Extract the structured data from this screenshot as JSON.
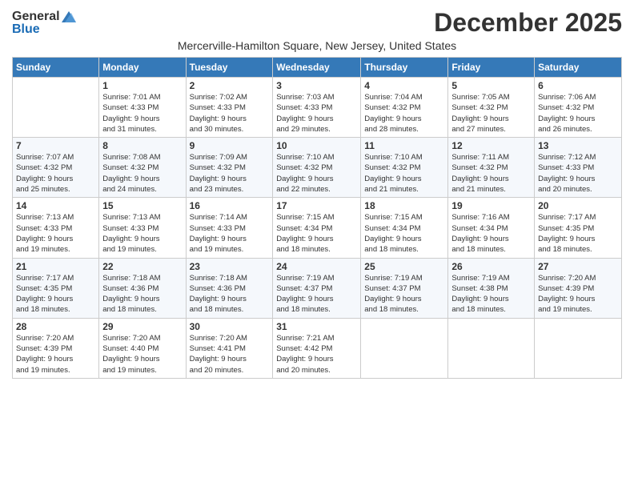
{
  "logo": {
    "general": "General",
    "blue": "Blue"
  },
  "title": "December 2025",
  "subtitle": "Mercerville-Hamilton Square, New Jersey, United States",
  "days_of_week": [
    "Sunday",
    "Monday",
    "Tuesday",
    "Wednesday",
    "Thursday",
    "Friday",
    "Saturday"
  ],
  "weeks": [
    [
      {
        "day": "",
        "info": ""
      },
      {
        "day": "1",
        "info": "Sunrise: 7:01 AM\nSunset: 4:33 PM\nDaylight: 9 hours\nand 31 minutes."
      },
      {
        "day": "2",
        "info": "Sunrise: 7:02 AM\nSunset: 4:33 PM\nDaylight: 9 hours\nand 30 minutes."
      },
      {
        "day": "3",
        "info": "Sunrise: 7:03 AM\nSunset: 4:33 PM\nDaylight: 9 hours\nand 29 minutes."
      },
      {
        "day": "4",
        "info": "Sunrise: 7:04 AM\nSunset: 4:32 PM\nDaylight: 9 hours\nand 28 minutes."
      },
      {
        "day": "5",
        "info": "Sunrise: 7:05 AM\nSunset: 4:32 PM\nDaylight: 9 hours\nand 27 minutes."
      },
      {
        "day": "6",
        "info": "Sunrise: 7:06 AM\nSunset: 4:32 PM\nDaylight: 9 hours\nand 26 minutes."
      }
    ],
    [
      {
        "day": "7",
        "info": "Sunrise: 7:07 AM\nSunset: 4:32 PM\nDaylight: 9 hours\nand 25 minutes."
      },
      {
        "day": "8",
        "info": "Sunrise: 7:08 AM\nSunset: 4:32 PM\nDaylight: 9 hours\nand 24 minutes."
      },
      {
        "day": "9",
        "info": "Sunrise: 7:09 AM\nSunset: 4:32 PM\nDaylight: 9 hours\nand 23 minutes."
      },
      {
        "day": "10",
        "info": "Sunrise: 7:10 AM\nSunset: 4:32 PM\nDaylight: 9 hours\nand 22 minutes."
      },
      {
        "day": "11",
        "info": "Sunrise: 7:10 AM\nSunset: 4:32 PM\nDaylight: 9 hours\nand 21 minutes."
      },
      {
        "day": "12",
        "info": "Sunrise: 7:11 AM\nSunset: 4:32 PM\nDaylight: 9 hours\nand 21 minutes."
      },
      {
        "day": "13",
        "info": "Sunrise: 7:12 AM\nSunset: 4:33 PM\nDaylight: 9 hours\nand 20 minutes."
      }
    ],
    [
      {
        "day": "14",
        "info": "Sunrise: 7:13 AM\nSunset: 4:33 PM\nDaylight: 9 hours\nand 19 minutes."
      },
      {
        "day": "15",
        "info": "Sunrise: 7:13 AM\nSunset: 4:33 PM\nDaylight: 9 hours\nand 19 minutes."
      },
      {
        "day": "16",
        "info": "Sunrise: 7:14 AM\nSunset: 4:33 PM\nDaylight: 9 hours\nand 19 minutes."
      },
      {
        "day": "17",
        "info": "Sunrise: 7:15 AM\nSunset: 4:34 PM\nDaylight: 9 hours\nand 18 minutes."
      },
      {
        "day": "18",
        "info": "Sunrise: 7:15 AM\nSunset: 4:34 PM\nDaylight: 9 hours\nand 18 minutes."
      },
      {
        "day": "19",
        "info": "Sunrise: 7:16 AM\nSunset: 4:34 PM\nDaylight: 9 hours\nand 18 minutes."
      },
      {
        "day": "20",
        "info": "Sunrise: 7:17 AM\nSunset: 4:35 PM\nDaylight: 9 hours\nand 18 minutes."
      }
    ],
    [
      {
        "day": "21",
        "info": "Sunrise: 7:17 AM\nSunset: 4:35 PM\nDaylight: 9 hours\nand 18 minutes."
      },
      {
        "day": "22",
        "info": "Sunrise: 7:18 AM\nSunset: 4:36 PM\nDaylight: 9 hours\nand 18 minutes."
      },
      {
        "day": "23",
        "info": "Sunrise: 7:18 AM\nSunset: 4:36 PM\nDaylight: 9 hours\nand 18 minutes."
      },
      {
        "day": "24",
        "info": "Sunrise: 7:19 AM\nSunset: 4:37 PM\nDaylight: 9 hours\nand 18 minutes."
      },
      {
        "day": "25",
        "info": "Sunrise: 7:19 AM\nSunset: 4:37 PM\nDaylight: 9 hours\nand 18 minutes."
      },
      {
        "day": "26",
        "info": "Sunrise: 7:19 AM\nSunset: 4:38 PM\nDaylight: 9 hours\nand 18 minutes."
      },
      {
        "day": "27",
        "info": "Sunrise: 7:20 AM\nSunset: 4:39 PM\nDaylight: 9 hours\nand 19 minutes."
      }
    ],
    [
      {
        "day": "28",
        "info": "Sunrise: 7:20 AM\nSunset: 4:39 PM\nDaylight: 9 hours\nand 19 minutes."
      },
      {
        "day": "29",
        "info": "Sunrise: 7:20 AM\nSunset: 4:40 PM\nDaylight: 9 hours\nand 19 minutes."
      },
      {
        "day": "30",
        "info": "Sunrise: 7:20 AM\nSunset: 4:41 PM\nDaylight: 9 hours\nand 20 minutes."
      },
      {
        "day": "31",
        "info": "Sunrise: 7:21 AM\nSunset: 4:42 PM\nDaylight: 9 hours\nand 20 minutes."
      },
      {
        "day": "",
        "info": ""
      },
      {
        "day": "",
        "info": ""
      },
      {
        "day": "",
        "info": ""
      }
    ]
  ]
}
